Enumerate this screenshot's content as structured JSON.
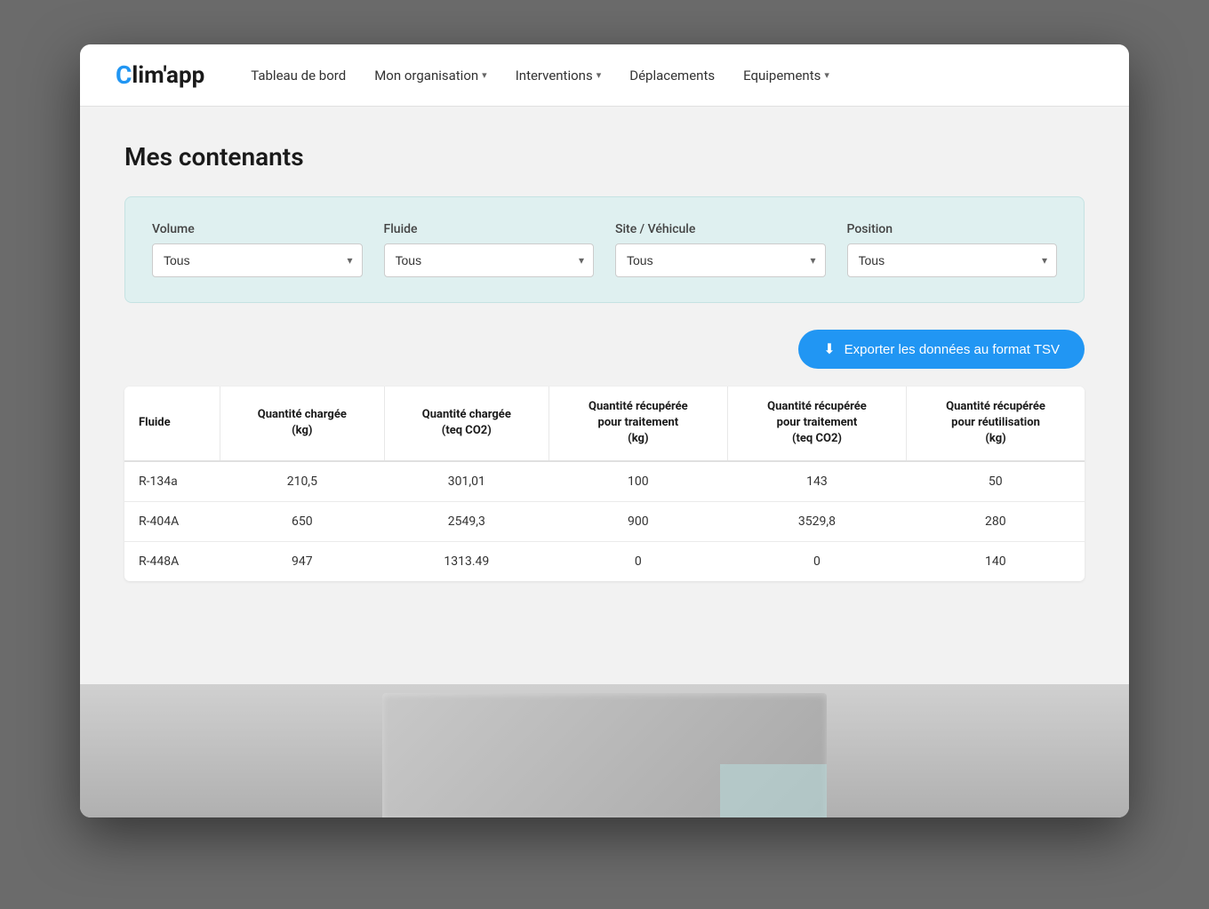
{
  "app": {
    "logo": "Clim'app",
    "logo_c": "C",
    "logo_rest": "lim'app"
  },
  "nav": {
    "items": [
      {
        "label": "Tableau de bord",
        "has_dropdown": false
      },
      {
        "label": "Mon organisation",
        "has_dropdown": true
      },
      {
        "label": "Interventions",
        "has_dropdown": true
      },
      {
        "label": "Déplacements",
        "has_dropdown": false
      },
      {
        "label": "Equipements",
        "has_dropdown": true
      }
    ]
  },
  "page": {
    "title": "Mes contenants"
  },
  "filters": {
    "volume": {
      "label": "Volume",
      "default": "Tous"
    },
    "fluide": {
      "label": "Fluide",
      "default": "Tous"
    },
    "site_vehicule": {
      "label": "Site / Véhicule",
      "default": "Tous"
    },
    "position": {
      "label": "Position",
      "default": "Tous"
    }
  },
  "export_btn": "Exporter les données au format TSV",
  "table": {
    "columns": [
      "Fluide",
      "Quantité chargée (kg)",
      "Quantité chargée (teq CO2)",
      "Quantité récupérée pour traitement (kg)",
      "Quantité récupérée pour traitement (teq CO2)",
      "Quantité récupérée pour réutilisation (kg)"
    ],
    "rows": [
      {
        "fluide": "R-134a",
        "qty_charged_kg": "210,5",
        "qty_charged_teq": "301,01",
        "qty_recovered_treatment_kg": "100",
        "qty_recovered_treatment_teq": "143",
        "qty_recovered_reuse_kg": "50"
      },
      {
        "fluide": "R-404A",
        "qty_charged_kg": "650",
        "qty_charged_teq": "2549,3",
        "qty_recovered_treatment_kg": "900",
        "qty_recovered_treatment_teq": "3529,8",
        "qty_recovered_reuse_kg": "280"
      },
      {
        "fluide": "R-448A",
        "qty_charged_kg": "947",
        "qty_charged_teq": "1313.49",
        "qty_recovered_treatment_kg": "0",
        "qty_recovered_treatment_teq": "0",
        "qty_recovered_reuse_kg": "140"
      }
    ]
  }
}
